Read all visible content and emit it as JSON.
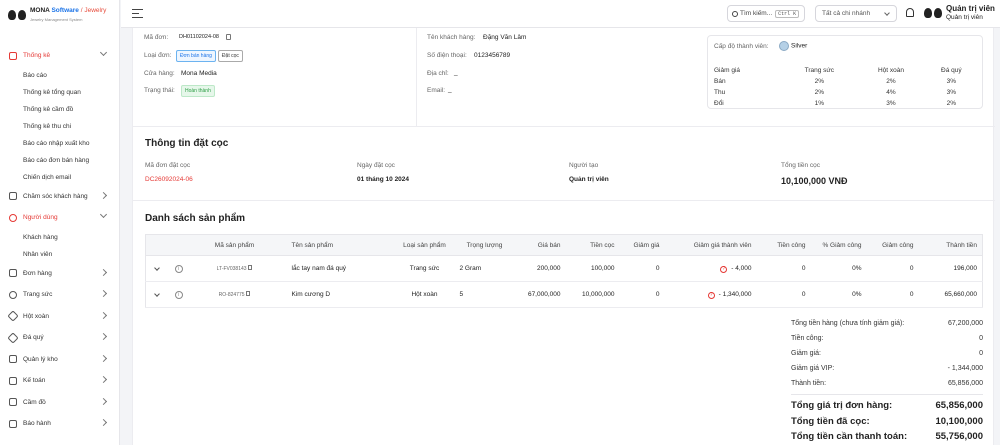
{
  "brand": {
    "name_main": "MONA",
    "name_software": "Software",
    "name_sep": "/",
    "name_jewelry": "Jewelry",
    "tagline": "Jewelry Management System"
  },
  "sidebar": {
    "sections": [
      {
        "label": "Thống kê",
        "icon": "chart-icon",
        "open": true,
        "active": true,
        "children": [
          "Báo cáo",
          "Thống kê tổng quan",
          "Thống kê cầm đồ",
          "Thống kê thu chi",
          "Báo cáo nhập xuất kho",
          "Báo cáo đơn bán hàng",
          "Chiến dịch email"
        ]
      },
      {
        "label": "Chăm sóc khách hàng",
        "icon": "headset-icon",
        "open": false
      },
      {
        "label": "Người dùng",
        "icon": "user-icon",
        "open": true,
        "active": true,
        "children": [
          "Khách hàng",
          "Nhân viên"
        ]
      },
      {
        "label": "Đơn hàng",
        "icon": "cart-icon",
        "open": false
      },
      {
        "label": "Trang sức",
        "icon": "ring-icon",
        "open": false
      },
      {
        "label": "Hột xoàn",
        "icon": "diamond-icon",
        "open": false
      },
      {
        "label": "Đá quý",
        "icon": "gem-icon",
        "open": false
      },
      {
        "label": "Quản lý kho",
        "icon": "warehouse-icon",
        "open": false
      },
      {
        "label": "Kế toán",
        "icon": "calculator-icon",
        "open": false
      },
      {
        "label": "Cầm đồ",
        "icon": "pawn-icon",
        "open": false
      },
      {
        "label": "Báo hành",
        "icon": "shield-icon",
        "open": false
      }
    ]
  },
  "topbar": {
    "search_label": "Tìm kiếm...",
    "search_shortcut": "Ctrl K",
    "branch_select": "Tất cả chi nhánh",
    "user_name": "Quản trị viên",
    "user_role": "Quản trị viên"
  },
  "order": {
    "code_label": "Mã đơn:",
    "code": "DH01102024-08",
    "type_label": "Loại đơn:",
    "type_tags": [
      "Đơn bán hàng",
      "Đặt cọc"
    ],
    "store_label": "Cửa hàng:",
    "store": "Mona Media",
    "status_label": "Trạng thái:",
    "status": "Hoàn thành",
    "customer_label": "Tên khách hàng:",
    "customer": "Đặng Văn Lâm",
    "phone_label": "Số điện thoại:",
    "phone": "0123456789",
    "address_label": "Địa chỉ:",
    "address": "_",
    "email_label": "Email:",
    "email": "_"
  },
  "membership": {
    "label": "Cấp độ thành viên:",
    "level": "Silver",
    "headers": [
      "Giảm giá",
      "Trang sức",
      "Hột xoàn",
      "Đá quý"
    ],
    "rows": [
      [
        "Bán",
        "2%",
        "2%",
        "3%"
      ],
      [
        "Thu",
        "2%",
        "4%",
        "3%"
      ],
      [
        "Đổi",
        "1%",
        "3%",
        "2%"
      ]
    ]
  },
  "deposit": {
    "title": "Thông tin đặt cọc",
    "code_label": "Mã đơn đặt cọc",
    "code": "DC26092024-06",
    "date_label": "Ngày đặt cọc",
    "date": "01 tháng 10 2024",
    "creator_label": "Người tạo",
    "creator": "Quản trị viên",
    "total_label": "Tổng tiền cọc",
    "total": "10,100,000 VNĐ"
  },
  "products": {
    "title": "Danh sách sản phẩm",
    "headers": [
      "Mã sản phẩm",
      "Tên sản phẩm",
      "Loại sản phẩm",
      "Trọng lượng",
      "Giá bán",
      "Tiền cọc",
      "Giảm giá",
      "Giảm giá thành viên",
      "Tiền công",
      "% Giảm công",
      "Giảm công",
      "Thành tiền"
    ],
    "rows": [
      {
        "code": "LT-FV038143",
        "name": "lắc tay nam đá quý",
        "type": "Trang sức",
        "weight": "2 Gram",
        "price": "200,000",
        "deposit": "100,000",
        "discount": "0",
        "member_discount": "- 4,000",
        "labor": "0",
        "labor_pct": "0%",
        "labor_discount": "0",
        "total": "196,000"
      },
      {
        "code": "RO-824775",
        "name": "Kim cương D",
        "type": "Hột xoàn",
        "weight": "5",
        "price": "67,000,000",
        "deposit": "10,000,000",
        "discount": "0",
        "member_discount": "- 1,340,000",
        "labor": "0",
        "labor_pct": "0%",
        "labor_discount": "0",
        "total": "65,660,000"
      }
    ]
  },
  "summary": {
    "subtotal_label": "Tổng tiền hàng (chưa tính giảm giá):",
    "subtotal": "67,200,000",
    "labor_label": "Tiền công:",
    "labor": "0",
    "discount_label": "Giảm giá:",
    "discount": "0",
    "vip_label": "Giảm giá VIP:",
    "vip": "- 1,344,000",
    "amount_label": "Thành tiền:",
    "amount": "65,856,000",
    "order_value_label": "Tổng giá trị đơn hàng:",
    "order_value": "65,856,000",
    "paid_label": "Tổng tiền đã cọc:",
    "paid": "10,100,000",
    "due_label": "Tổng tiền cần thanh toán:",
    "due": "55,756,000"
  },
  "colors": {
    "accent": "#e53935",
    "link": "#1a73e8",
    "success": "#2e9e46"
  }
}
